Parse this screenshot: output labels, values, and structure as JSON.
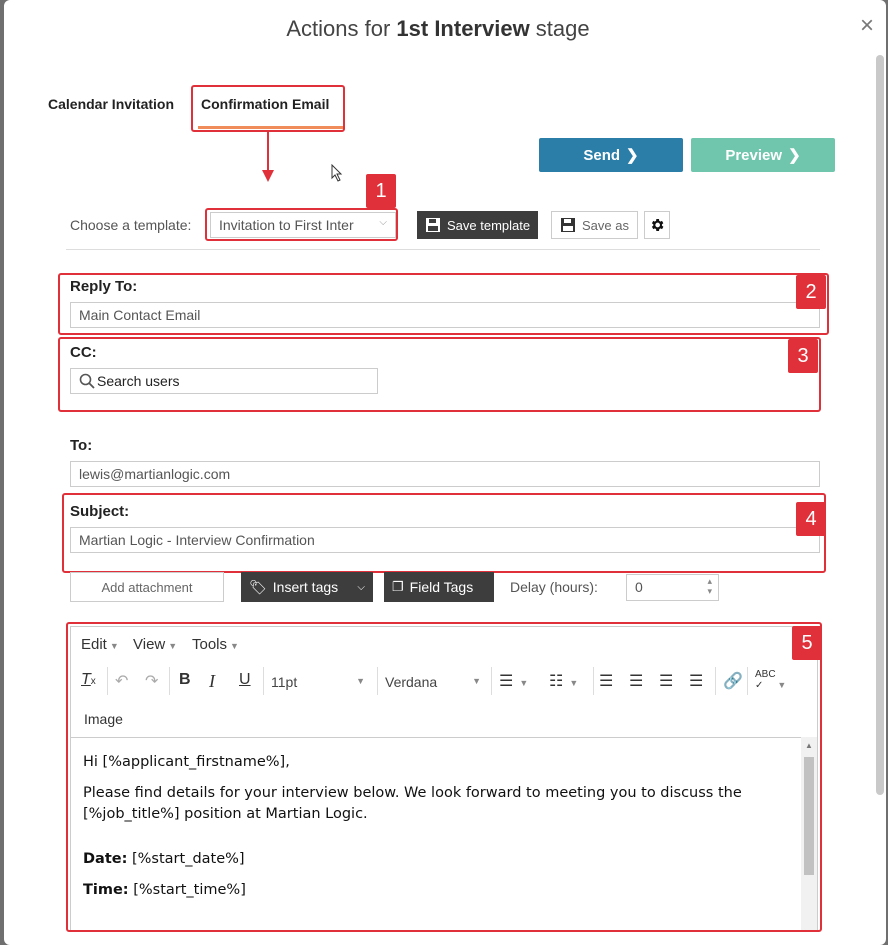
{
  "modal": {
    "title_prefix": "Actions for ",
    "title_stage": "1st Interview",
    "title_suffix": " stage",
    "close_glyph": "×"
  },
  "tabs": [
    {
      "label": "Calendar Invitation",
      "active": false
    },
    {
      "label": "Confirmation Email",
      "active": true
    }
  ],
  "actions": {
    "send_label": "Send",
    "preview_label": "Preview",
    "send_color": "#2a7ea8",
    "preview_color": "#6fc6ac"
  },
  "template": {
    "label": "Choose a template:",
    "selected": "Invitation to First Inter",
    "save_template_label": "Save template",
    "save_as_label": "Save as"
  },
  "fields": {
    "reply_to_label": "Reply To:",
    "reply_to_value": "Main Contact Email",
    "cc_label": "CC:",
    "cc_placeholder": "Search users",
    "to_label": "To:",
    "to_value": "lewis@martianlogic.com",
    "subject_label": "Subject:",
    "subject_value": "Martian Logic - Interview Confirmation"
  },
  "tools_row": {
    "add_attachment": "Add attachment",
    "insert_tags": "Insert tags",
    "field_tags": "Field Tags",
    "delay_label": "Delay (hours):",
    "delay_value": "0"
  },
  "editor": {
    "menus": [
      "Edit",
      "View",
      "Tools"
    ],
    "font_size": "11pt",
    "font_family": "Verdana",
    "image_label": "Image",
    "greeting": "Hi [%applicant_firstname%],",
    "body": "Please find details for your interview below. We look forward to meeting you to discuss the [%job_title%] position at Martian Logic.",
    "date_label": "Date:",
    "date_value": " [%start_date%]",
    "time_label": "Time:",
    "time_value": " [%start_time%]"
  },
  "annotations": {
    "badges": [
      "1",
      "2",
      "3",
      "4",
      "5"
    ],
    "accent_color": "#e0303a"
  }
}
